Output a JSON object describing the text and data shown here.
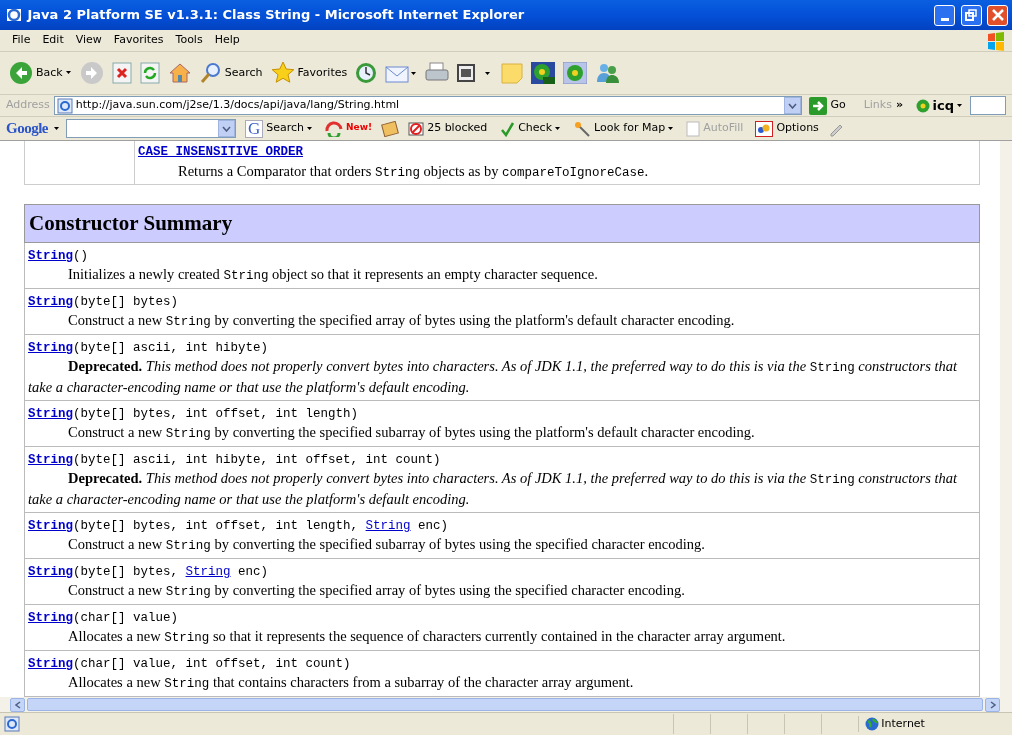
{
  "window": {
    "title": "Java 2 Platform SE v1.3.1: Class String - Microsoft Internet Explorer"
  },
  "menu": [
    "File",
    "Edit",
    "View",
    "Favorites",
    "Tools",
    "Help"
  ],
  "toolbar": [
    {
      "kind": "back",
      "label": "Back"
    },
    {
      "kind": "forward"
    },
    {
      "kind": "stop"
    },
    {
      "kind": "refresh"
    },
    {
      "kind": "home"
    },
    {
      "kind": "search",
      "label": "Search"
    },
    {
      "kind": "favorites",
      "label": "Favorites"
    },
    {
      "kind": "history"
    },
    {
      "kind": "mail"
    },
    {
      "kind": "print"
    },
    {
      "kind": "edit"
    },
    {
      "kind": "note"
    },
    {
      "kind": "flowerpro"
    },
    {
      "kind": "flower"
    },
    {
      "kind": "people"
    }
  ],
  "address": {
    "label": "Address",
    "value": "http://java.sun.com/j2se/1.3/docs/api/java/lang/String.html",
    "go": "Go",
    "links": "Links",
    "chevron": "»",
    "icq": "icq"
  },
  "google_bar": {
    "logo": "Google",
    "search": "G",
    "search_label": "Search",
    "new_badge": "New!",
    "blocked": "25 blocked",
    "check": "Check",
    "map": "Look for Map",
    "autofill": "AutoFill",
    "autofill_disabled": true,
    "options": "Options"
  },
  "field_row": {
    "name": "CASE_INSENSITIVE_ORDER",
    "description": [
      {
        "kind": "plain",
        "text": "Returns a Comparator that orders "
      },
      {
        "kind": "code",
        "text": "String"
      },
      {
        "kind": "plain",
        "text": " objects as by "
      },
      {
        "kind": "code",
        "text": "compareToIgnoreCase"
      },
      {
        "kind": "plain",
        "text": "."
      }
    ]
  },
  "section": {
    "title": "Constructor Summary"
  },
  "constructors": [
    {
      "signature": [
        {
          "kind": "link",
          "text": "String"
        },
        {
          "kind": "code",
          "text": "()"
        }
      ],
      "deprecated": false,
      "description": [
        {
          "kind": "plain",
          "text": "Initializes a newly created "
        },
        {
          "kind": "code",
          "text": "String"
        },
        {
          "kind": "plain",
          "text": " object so that it represents an empty character sequence."
        }
      ]
    },
    {
      "signature": [
        {
          "kind": "link",
          "text": "String"
        },
        {
          "kind": "code",
          "text": "(byte[] bytes)"
        }
      ],
      "deprecated": false,
      "description": [
        {
          "kind": "plain",
          "text": "Construct a new "
        },
        {
          "kind": "code",
          "text": "String"
        },
        {
          "kind": "plain",
          "text": " by converting the specified array of bytes using the platform's default character encoding."
        }
      ]
    },
    {
      "signature": [
        {
          "kind": "link",
          "text": "String"
        },
        {
          "kind": "code",
          "text": "(byte[] ascii, int hibyte)"
        }
      ],
      "deprecated": true,
      "description": [
        {
          "kind": "bold",
          "text": "Deprecated."
        },
        {
          "kind": "italic",
          "text": " This method does not properly convert bytes into characters. As of JDK 1.1, the preferred way to do this is via the "
        },
        {
          "kind": "code",
          "text": "String"
        },
        {
          "kind": "italic",
          "text": " constructors that take a character-encoding name or that use the platform's default encoding."
        }
      ]
    },
    {
      "signature": [
        {
          "kind": "link",
          "text": "String"
        },
        {
          "kind": "code",
          "text": "(byte[] bytes, int offset, int length)"
        }
      ],
      "deprecated": false,
      "description": [
        {
          "kind": "plain",
          "text": "Construct a new "
        },
        {
          "kind": "code",
          "text": "String"
        },
        {
          "kind": "plain",
          "text": " by converting the specified subarray of bytes using the platform's default character encoding."
        }
      ]
    },
    {
      "signature": [
        {
          "kind": "link",
          "text": "String"
        },
        {
          "kind": "code",
          "text": "(byte[] ascii, int hibyte, int offset, int count)"
        }
      ],
      "deprecated": true,
      "description": [
        {
          "kind": "bold",
          "text": "Deprecated."
        },
        {
          "kind": "italic",
          "text": " This method does not properly convert bytes into characters. As of JDK 1.1, the preferred way to do this is via the "
        },
        {
          "kind": "code",
          "text": "String"
        },
        {
          "kind": "italic",
          "text": " constructors that take a character-encoding name or that use the platform's default encoding."
        }
      ]
    },
    {
      "signature": [
        {
          "kind": "link",
          "text": "String"
        },
        {
          "kind": "code",
          "text": "(byte[] bytes, int offset, int length, "
        },
        {
          "kind": "plainlink",
          "text": "String"
        },
        {
          "kind": "code",
          "text": " enc)"
        }
      ],
      "deprecated": false,
      "description": [
        {
          "kind": "plain",
          "text": "Construct a new "
        },
        {
          "kind": "code",
          "text": "String"
        },
        {
          "kind": "plain",
          "text": " by converting the specified subarray of bytes using the specified character encoding."
        }
      ]
    },
    {
      "signature": [
        {
          "kind": "link",
          "text": "String"
        },
        {
          "kind": "code",
          "text": "(byte[] bytes, "
        },
        {
          "kind": "plainlink",
          "text": "String"
        },
        {
          "kind": "code",
          "text": " enc)"
        }
      ],
      "deprecated": false,
      "description": [
        {
          "kind": "plain",
          "text": "Construct a new "
        },
        {
          "kind": "code",
          "text": "String"
        },
        {
          "kind": "plain",
          "text": " by converting the specified array of bytes using the specified character encoding."
        }
      ]
    },
    {
      "signature": [
        {
          "kind": "link",
          "text": "String"
        },
        {
          "kind": "code",
          "text": "(char[] value)"
        }
      ],
      "deprecated": false,
      "description": [
        {
          "kind": "plain",
          "text": "Allocates a new "
        },
        {
          "kind": "code",
          "text": "String"
        },
        {
          "kind": "plain",
          "text": " so that it represents the sequence of characters currently contained in the character array argument."
        }
      ]
    },
    {
      "signature": [
        {
          "kind": "link",
          "text": "String"
        },
        {
          "kind": "code",
          "text": "(char[] value, int offset, int count)"
        }
      ],
      "deprecated": false,
      "description": [
        {
          "kind": "plain",
          "text": "Allocates a new "
        },
        {
          "kind": "code",
          "text": "String"
        },
        {
          "kind": "plain",
          "text": " that contains characters from a subarray of the character array argument."
        }
      ]
    }
  ],
  "status_bar": {
    "zone": "Internet"
  }
}
